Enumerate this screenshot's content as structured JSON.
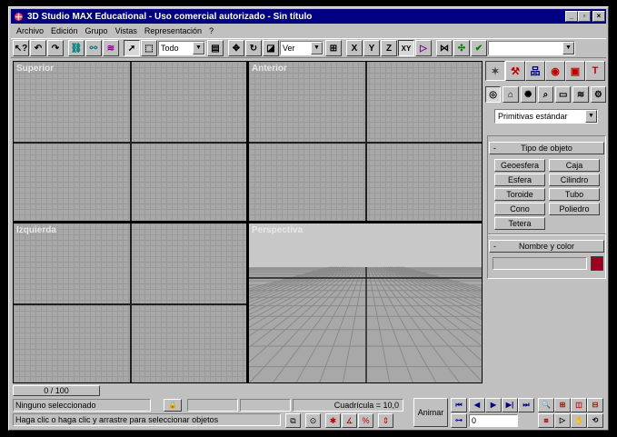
{
  "window": {
    "title": "3D Studio MAX Educational - Uso comercial autorizado - Sin título",
    "minimize": "_",
    "maximize": "▫",
    "close": "×"
  },
  "menu": [
    {
      "label": "Archivo"
    },
    {
      "label": "Edición"
    },
    {
      "label": "Grupo"
    },
    {
      "label": "Vistas"
    },
    {
      "label": "Representación"
    },
    {
      "label": "?"
    }
  ],
  "toolbar": {
    "selection_filter": "Todo",
    "reference_coord": "Ver",
    "axis_x": "X",
    "axis_y": "Y",
    "axis_z": "Z",
    "axis_xy": "XY",
    "named_selection": ""
  },
  "viewports": {
    "top": "Superior",
    "front": "Anterior",
    "left": "Izquierda",
    "perspective": "Perspectiva"
  },
  "time": {
    "slider": "0 / 100"
  },
  "status": {
    "selection": "Ninguno seleccionado",
    "prompt": "Haga clic o haga clic y arrastre para seleccionar objetos",
    "grid": "Cuadrícula = 10,0"
  },
  "animation": {
    "animate_label": "Animar",
    "current_frame": "0"
  },
  "command_panel": {
    "category_dropdown": "Primitivas estándar",
    "object_type_title": "Tipo de objeto",
    "collapse_symbol": "-",
    "buttons": [
      "Geoesfera",
      "Caja",
      "Esfera",
      "Cilindro",
      "Toroide",
      "Tubo",
      "Cono",
      "Poliedro",
      "Tetera"
    ],
    "name_color_title": "Nombre y color",
    "name_value": "",
    "object_color": "#a00020"
  },
  "colors": {
    "title_bar": "#000080",
    "viewport_bg": "#a8a8a8",
    "perspective_sky": "#c8c8c8"
  }
}
